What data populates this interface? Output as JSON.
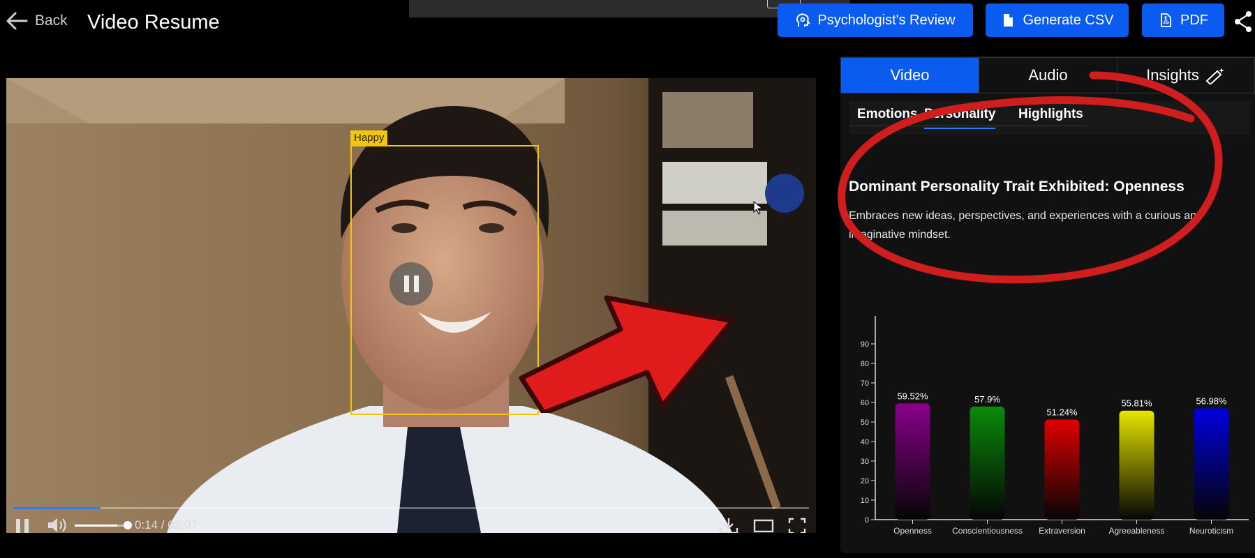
{
  "header": {
    "back_label": "Back",
    "title": "Video Resume",
    "buttons": {
      "psychologist_review": "Psychologist's Review",
      "generate_csv": "Generate CSV",
      "pdf": "PDF"
    }
  },
  "video": {
    "detection_label": "Happy",
    "time": "0:14 / 02:07",
    "progress": 0.11,
    "volume": 0.85
  },
  "panel": {
    "tabs": {
      "video": "Video",
      "audio": "Audio",
      "insights": "Insights"
    },
    "active_tab": "Video",
    "sub_tabs": {
      "emotions": "Emotions",
      "personality": "Personality",
      "highlights": "Highlights"
    },
    "active_sub_tab": "Personality",
    "trait_heading": "Dominant Personality Trait Exhibited: Openness",
    "trait_description": "Embraces new ideas, perspectives, and experiences with a curious and imaginative mindset."
  },
  "colors": {
    "accent": "#0a5cf0",
    "detection": "#f2c60a",
    "annotation_red": "#e01b1b"
  },
  "chart_data": {
    "type": "bar",
    "categories": [
      "Openness",
      "Conscientiousness",
      "Extraversion",
      "Agreeableness",
      "Neuroticism"
    ],
    "values": [
      59.52,
      57.9,
      51.24,
      55.81,
      56.98
    ],
    "value_labels": [
      "59.52%",
      "57.9%",
      "51.24%",
      "55.81%",
      "56.98%"
    ],
    "colors": [
      "#8a008a",
      "#0b8a0b",
      "#e00000",
      "#e6e600",
      "#0000e0"
    ],
    "ylim": [
      0,
      100
    ],
    "yticks": [
      0,
      10,
      20,
      30,
      40,
      50,
      60,
      70,
      80,
      90
    ],
    "grid": false,
    "title": "",
    "xlabel": "",
    "ylabel": ""
  }
}
